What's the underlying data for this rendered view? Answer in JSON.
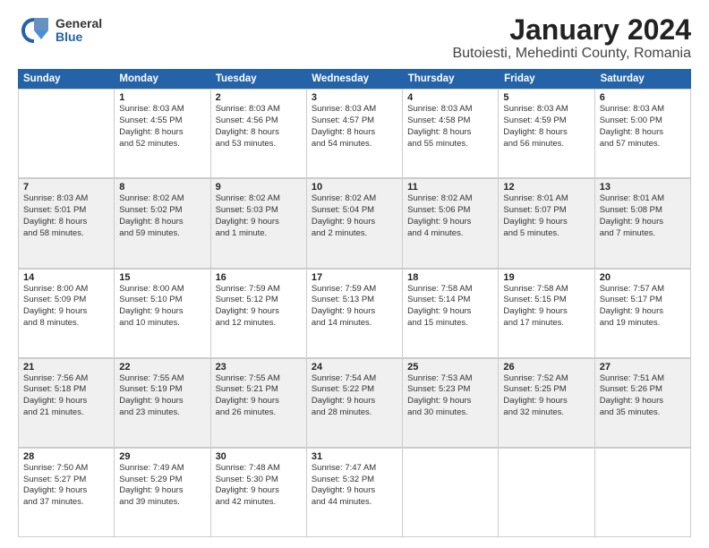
{
  "logo": {
    "general": "General",
    "blue": "Blue"
  },
  "title": "January 2024",
  "subtitle": "Butoiesti, Mehedinti County, Romania",
  "header_days": [
    "Sunday",
    "Monday",
    "Tuesday",
    "Wednesday",
    "Thursday",
    "Friday",
    "Saturday"
  ],
  "weeks": [
    [
      {
        "num": "",
        "lines": []
      },
      {
        "num": "1",
        "lines": [
          "Sunrise: 8:03 AM",
          "Sunset: 4:55 PM",
          "Daylight: 8 hours",
          "and 52 minutes."
        ]
      },
      {
        "num": "2",
        "lines": [
          "Sunrise: 8:03 AM",
          "Sunset: 4:56 PM",
          "Daylight: 8 hours",
          "and 53 minutes."
        ]
      },
      {
        "num": "3",
        "lines": [
          "Sunrise: 8:03 AM",
          "Sunset: 4:57 PM",
          "Daylight: 8 hours",
          "and 54 minutes."
        ]
      },
      {
        "num": "4",
        "lines": [
          "Sunrise: 8:03 AM",
          "Sunset: 4:58 PM",
          "Daylight: 8 hours",
          "and 55 minutes."
        ]
      },
      {
        "num": "5",
        "lines": [
          "Sunrise: 8:03 AM",
          "Sunset: 4:59 PM",
          "Daylight: 8 hours",
          "and 56 minutes."
        ]
      },
      {
        "num": "6",
        "lines": [
          "Sunrise: 8:03 AM",
          "Sunset: 5:00 PM",
          "Daylight: 8 hours",
          "and 57 minutes."
        ]
      }
    ],
    [
      {
        "num": "7",
        "lines": [
          "Sunrise: 8:03 AM",
          "Sunset: 5:01 PM",
          "Daylight: 8 hours",
          "and 58 minutes."
        ]
      },
      {
        "num": "8",
        "lines": [
          "Sunrise: 8:02 AM",
          "Sunset: 5:02 PM",
          "Daylight: 8 hours",
          "and 59 minutes."
        ]
      },
      {
        "num": "9",
        "lines": [
          "Sunrise: 8:02 AM",
          "Sunset: 5:03 PM",
          "Daylight: 9 hours",
          "and 1 minute."
        ]
      },
      {
        "num": "10",
        "lines": [
          "Sunrise: 8:02 AM",
          "Sunset: 5:04 PM",
          "Daylight: 9 hours",
          "and 2 minutes."
        ]
      },
      {
        "num": "11",
        "lines": [
          "Sunrise: 8:02 AM",
          "Sunset: 5:06 PM",
          "Daylight: 9 hours",
          "and 4 minutes."
        ]
      },
      {
        "num": "12",
        "lines": [
          "Sunrise: 8:01 AM",
          "Sunset: 5:07 PM",
          "Daylight: 9 hours",
          "and 5 minutes."
        ]
      },
      {
        "num": "13",
        "lines": [
          "Sunrise: 8:01 AM",
          "Sunset: 5:08 PM",
          "Daylight: 9 hours",
          "and 7 minutes."
        ]
      }
    ],
    [
      {
        "num": "14",
        "lines": [
          "Sunrise: 8:00 AM",
          "Sunset: 5:09 PM",
          "Daylight: 9 hours",
          "and 8 minutes."
        ]
      },
      {
        "num": "15",
        "lines": [
          "Sunrise: 8:00 AM",
          "Sunset: 5:10 PM",
          "Daylight: 9 hours",
          "and 10 minutes."
        ]
      },
      {
        "num": "16",
        "lines": [
          "Sunrise: 7:59 AM",
          "Sunset: 5:12 PM",
          "Daylight: 9 hours",
          "and 12 minutes."
        ]
      },
      {
        "num": "17",
        "lines": [
          "Sunrise: 7:59 AM",
          "Sunset: 5:13 PM",
          "Daylight: 9 hours",
          "and 14 minutes."
        ]
      },
      {
        "num": "18",
        "lines": [
          "Sunrise: 7:58 AM",
          "Sunset: 5:14 PM",
          "Daylight: 9 hours",
          "and 15 minutes."
        ]
      },
      {
        "num": "19",
        "lines": [
          "Sunrise: 7:58 AM",
          "Sunset: 5:15 PM",
          "Daylight: 9 hours",
          "and 17 minutes."
        ]
      },
      {
        "num": "20",
        "lines": [
          "Sunrise: 7:57 AM",
          "Sunset: 5:17 PM",
          "Daylight: 9 hours",
          "and 19 minutes."
        ]
      }
    ],
    [
      {
        "num": "21",
        "lines": [
          "Sunrise: 7:56 AM",
          "Sunset: 5:18 PM",
          "Daylight: 9 hours",
          "and 21 minutes."
        ]
      },
      {
        "num": "22",
        "lines": [
          "Sunrise: 7:55 AM",
          "Sunset: 5:19 PM",
          "Daylight: 9 hours",
          "and 23 minutes."
        ]
      },
      {
        "num": "23",
        "lines": [
          "Sunrise: 7:55 AM",
          "Sunset: 5:21 PM",
          "Daylight: 9 hours",
          "and 26 minutes."
        ]
      },
      {
        "num": "24",
        "lines": [
          "Sunrise: 7:54 AM",
          "Sunset: 5:22 PM",
          "Daylight: 9 hours",
          "and 28 minutes."
        ]
      },
      {
        "num": "25",
        "lines": [
          "Sunrise: 7:53 AM",
          "Sunset: 5:23 PM",
          "Daylight: 9 hours",
          "and 30 minutes."
        ]
      },
      {
        "num": "26",
        "lines": [
          "Sunrise: 7:52 AM",
          "Sunset: 5:25 PM",
          "Daylight: 9 hours",
          "and 32 minutes."
        ]
      },
      {
        "num": "27",
        "lines": [
          "Sunrise: 7:51 AM",
          "Sunset: 5:26 PM",
          "Daylight: 9 hours",
          "and 35 minutes."
        ]
      }
    ],
    [
      {
        "num": "28",
        "lines": [
          "Sunrise: 7:50 AM",
          "Sunset: 5:27 PM",
          "Daylight: 9 hours",
          "and 37 minutes."
        ]
      },
      {
        "num": "29",
        "lines": [
          "Sunrise: 7:49 AM",
          "Sunset: 5:29 PM",
          "Daylight: 9 hours",
          "and 39 minutes."
        ]
      },
      {
        "num": "30",
        "lines": [
          "Sunrise: 7:48 AM",
          "Sunset: 5:30 PM",
          "Daylight: 9 hours",
          "and 42 minutes."
        ]
      },
      {
        "num": "31",
        "lines": [
          "Sunrise: 7:47 AM",
          "Sunset: 5:32 PM",
          "Daylight: 9 hours",
          "and 44 minutes."
        ]
      },
      {
        "num": "",
        "lines": []
      },
      {
        "num": "",
        "lines": []
      },
      {
        "num": "",
        "lines": []
      }
    ]
  ]
}
